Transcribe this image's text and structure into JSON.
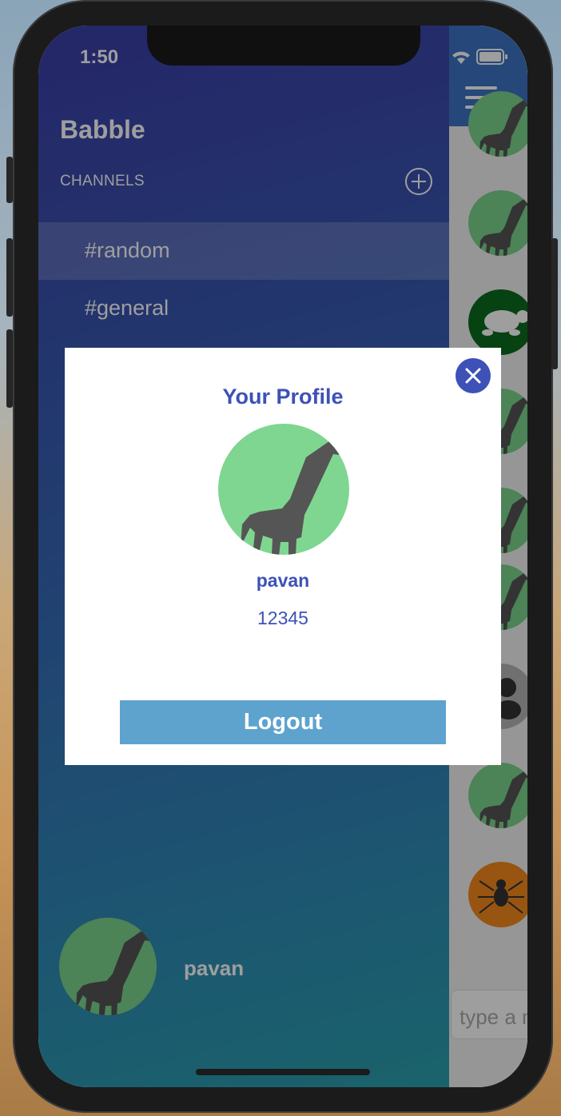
{
  "status_bar": {
    "time": "1:50"
  },
  "menu": {
    "title": "Babble",
    "channels_label": "CHANNELS",
    "add_channel_icon": "plus-circle-icon",
    "channels": [
      {
        "label": "#random",
        "selected": true
      },
      {
        "label": "#general",
        "selected": false
      }
    ],
    "user": {
      "name": "pavan",
      "avatar_icon": "giraffe-icon"
    }
  },
  "chat": {
    "menu_icon": "hamburger-icon",
    "input_placeholder": "type a message",
    "message_avatars": [
      "giraffe-icon",
      "giraffe-icon",
      "turtle-icon",
      "giraffe-icon",
      "giraffe-icon",
      "giraffe-icon",
      "person-icon",
      "giraffe-icon",
      "spider-icon"
    ]
  },
  "profile_modal": {
    "title": "Your Profile",
    "avatar_icon": "giraffe-icon",
    "name": "pavan",
    "email": "12345",
    "logout_label": "Logout",
    "close_icon": "close-icon"
  },
  "colors": {
    "accent": "#3d51b7",
    "logout_button": "#5ea3ce",
    "avatar_green": "#7bd48d"
  }
}
